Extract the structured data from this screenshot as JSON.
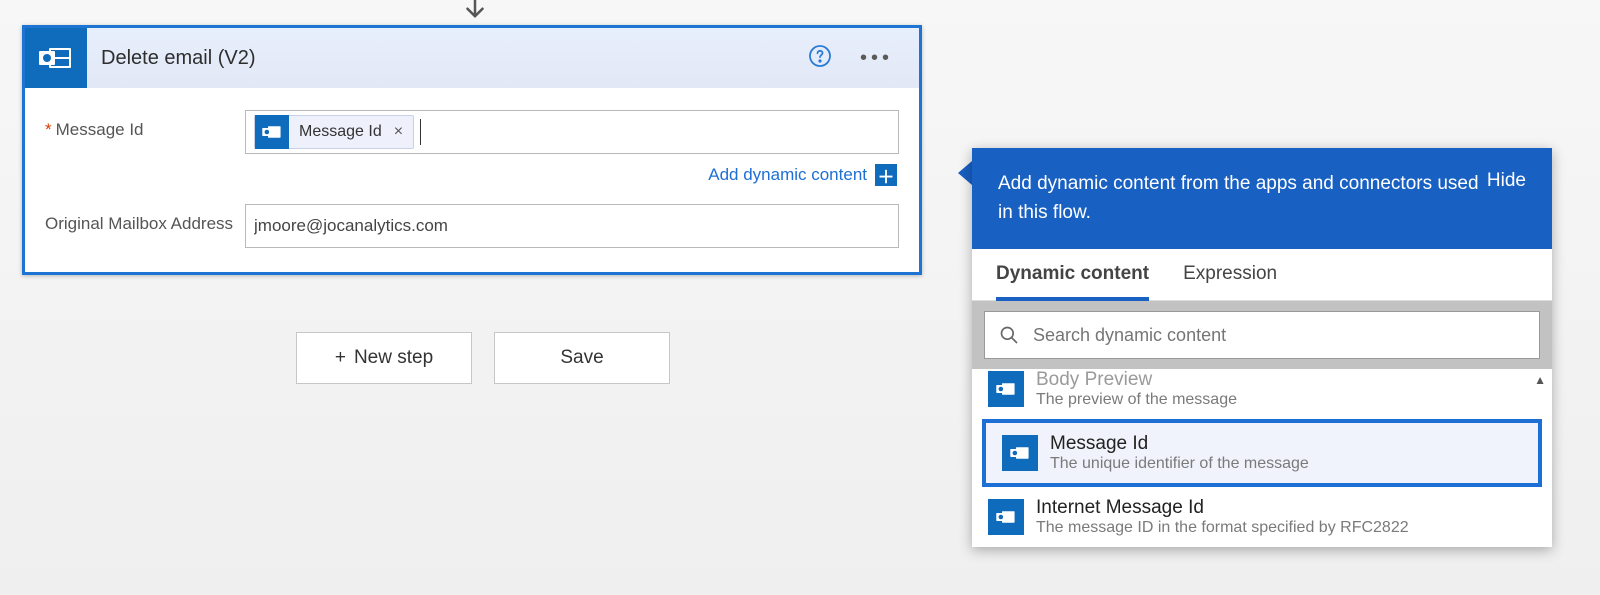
{
  "action": {
    "title": "Delete email (V2)",
    "fields": {
      "messageId": {
        "label": "Message Id",
        "tokenLabel": "Message Id",
        "required": true
      },
      "mailbox": {
        "label": "Original Mailbox Address",
        "value": "jmoore@jocanalytics.com"
      }
    },
    "addDynamicLabel": "Add dynamic content"
  },
  "popup": {
    "heading": "Add dynamic content from the apps and connectors used in this flow.",
    "hideLabel": "Hide",
    "tabs": {
      "dynamic": "Dynamic content",
      "expression": "Expression"
    },
    "searchPlaceholder": "Search dynamic content",
    "items": [
      {
        "label": "Body Preview",
        "desc": "The preview of the message",
        "truncatedTop": true
      },
      {
        "label": "Message Id",
        "desc": "The unique identifier of the message",
        "selected": true
      },
      {
        "label": "Internet Message Id",
        "desc": "The message ID in the format specified by RFC2822"
      }
    ]
  },
  "footer": {
    "newStep": "New step",
    "save": "Save"
  }
}
